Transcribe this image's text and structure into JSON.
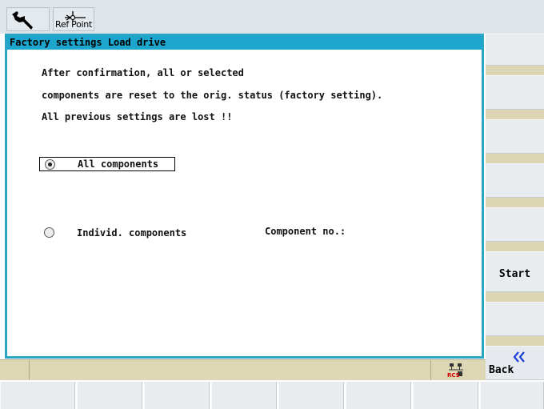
{
  "toolbar": {
    "ref_point_label": "Ref Point"
  },
  "dialog": {
    "title": "Factory settings Load drive",
    "line1": "After confirmation, all or selected",
    "line2": "components are reset to the orig. status (factory setting).",
    "line3": "All previous settings are lost !!",
    "option_all": "All components",
    "option_individual": "Individ. components",
    "component_no_label": "Component no.:",
    "selected_option": "All components"
  },
  "softkeys": {
    "vertical": [
      "",
      "",
      "",
      "",
      "",
      "Start",
      "",
      "Back"
    ],
    "start_label": "Start",
    "back_label": "Back"
  },
  "status": {
    "rcs_label": "RCS"
  },
  "colors": {
    "title_bar": "#1ca6cd",
    "dialog_border": "#2aa5c6",
    "separator": "#dcd6b4",
    "softkey": "#e8ecef",
    "back_arrow": "#1a3fd8",
    "rcs_red": "#d40000"
  }
}
